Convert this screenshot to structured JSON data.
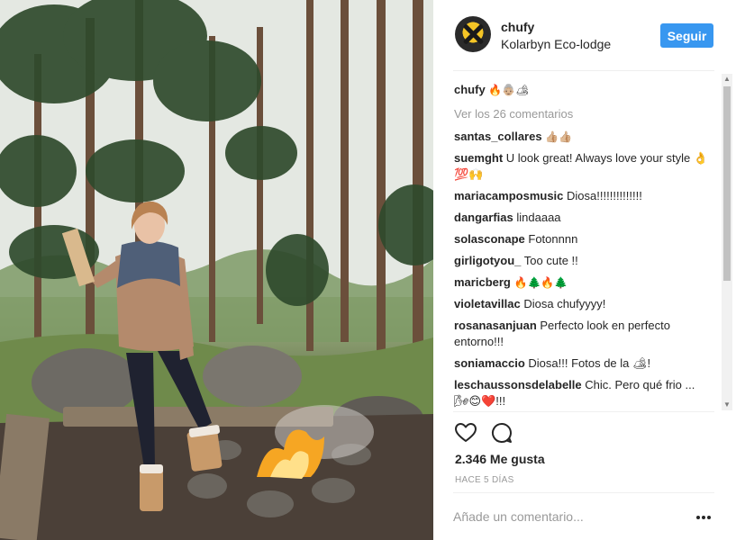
{
  "post": {
    "author": {
      "username": "chufy",
      "location": "Kolarbyn Eco-lodge",
      "follow_label": "Seguir"
    },
    "caption": {
      "username": "chufy",
      "text": "🔥👵🏼🏕"
    },
    "view_all_comments": "Ver los 26 comentarios",
    "comments": [
      {
        "username": "santas_collares",
        "text": "👍🏼👍🏼"
      },
      {
        "username": "suemght",
        "text": "U look great! Always love your style 👌💯🙌"
      },
      {
        "username": "mariacamposmusic",
        "text": "Diosa!!!!!!!!!!!!!!"
      },
      {
        "username": "dangarfias",
        "text": "lindaaaa"
      },
      {
        "username": "solasconape",
        "text": "Fotonnnn"
      },
      {
        "username": "girligotyou_",
        "text": "Too cute !!"
      },
      {
        "username": "maricberg",
        "text": "🔥🌲🔥🌲"
      },
      {
        "username": "violetavillac",
        "text": "Diosa chufyyyy!"
      },
      {
        "username": "rosanasanjuan",
        "text": "Perfecto look en perfecto entorno!!!"
      },
      {
        "username": "soniamaccio",
        "text": "Diosa!!! Fotos de la 🏕!"
      },
      {
        "username": "leschaussonsdelabelle",
        "text": "Chic. Pero qué frio ... 🌬😊❤️!!!"
      }
    ],
    "likes": "2.346 Me gusta",
    "timestamp": "HACE 5 DÍAS",
    "comment_placeholder": "Añade un comentario...",
    "icons": {
      "like": "heart-outline-icon",
      "comment": "speech-bubble-icon",
      "more": "more-horizontal-icon"
    }
  },
  "colors": {
    "accent": "#3897f0",
    "text": "#262626",
    "muted": "#999999",
    "divider": "#efefef"
  }
}
